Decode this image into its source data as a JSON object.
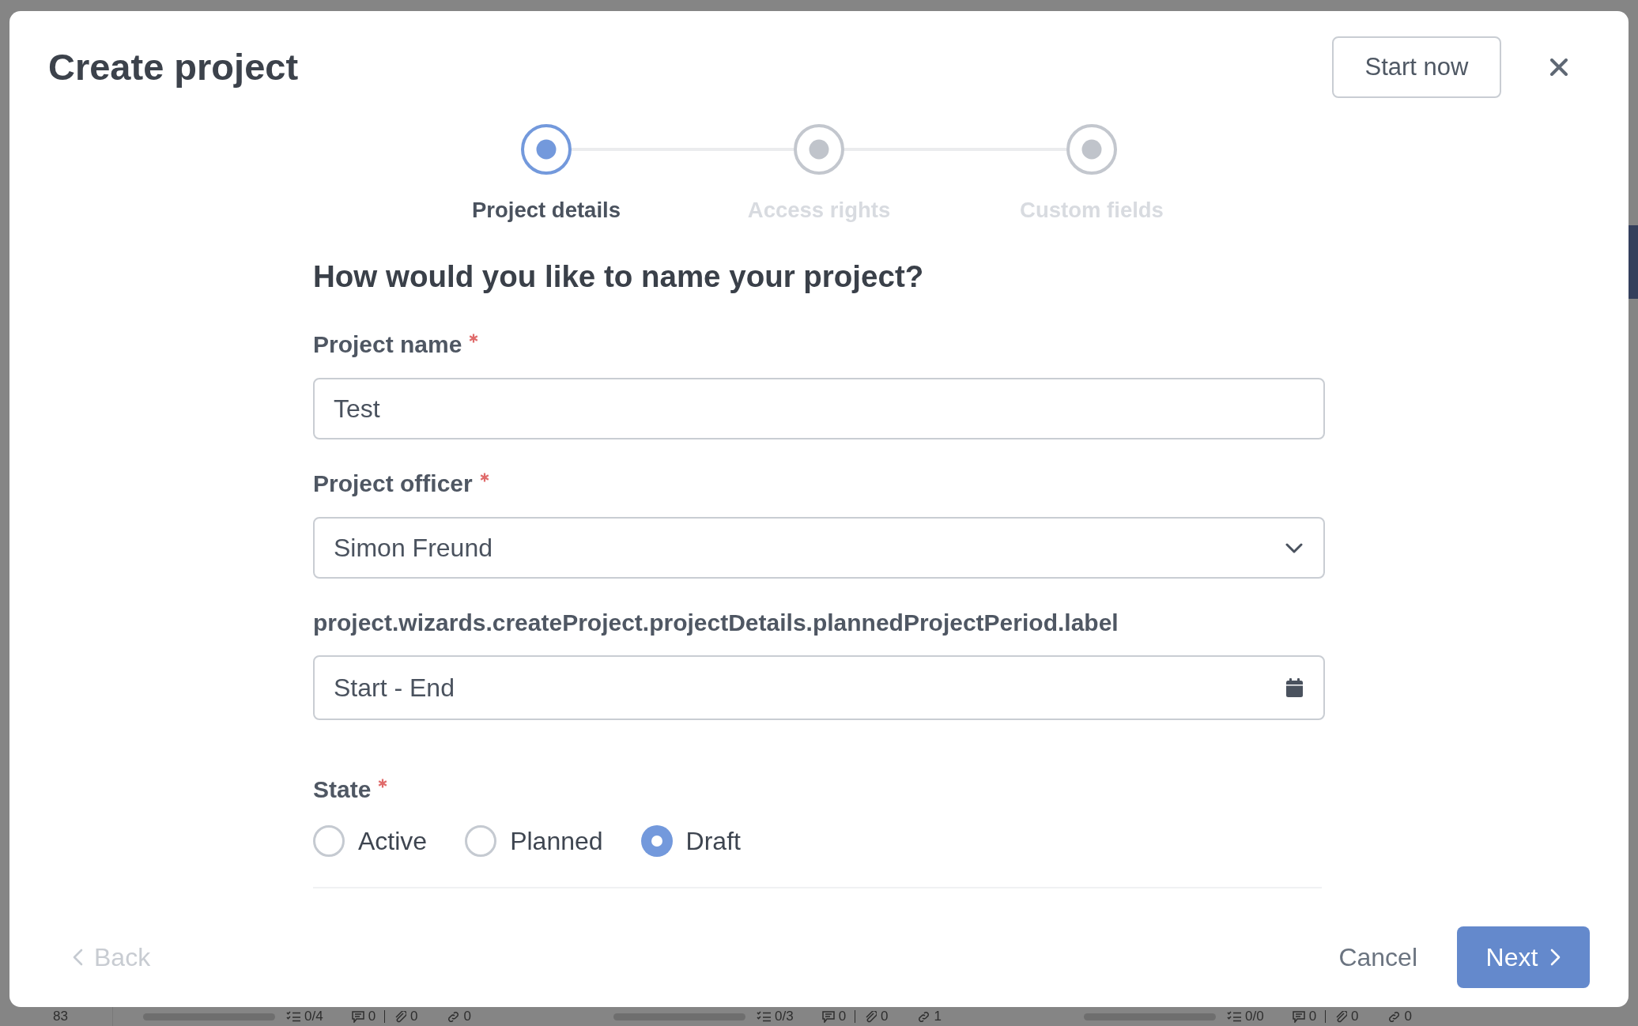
{
  "background": {
    "row_number": "83",
    "cards": [
      {
        "checklist": "0/4",
        "comments": "0",
        "attachments": "0",
        "links": "0"
      },
      {
        "checklist": "0/3",
        "comments": "0",
        "attachments": "0",
        "links": "1"
      },
      {
        "checklist": "0/0",
        "comments": "0",
        "attachments": "0",
        "links": "0"
      }
    ]
  },
  "dialog": {
    "title": "Create project",
    "start_button": "Start now",
    "steps": [
      {
        "label": "Project details",
        "selected": true
      },
      {
        "label": "Access rights",
        "selected": false
      },
      {
        "label": "Custom fields",
        "selected": false
      }
    ],
    "question": "How would you like to name your project?",
    "fields": [
      {
        "kind": "text",
        "label": "Project name",
        "required": true,
        "value": "Test"
      },
      {
        "kind": "select",
        "label": "Project officer",
        "required": true,
        "value": "Simon Freund"
      },
      {
        "kind": "date",
        "label": "project.wizards.createProject.projectDetails.plannedProjectPeriod.label",
        "required": false,
        "placeholder": "Start - End"
      }
    ],
    "state": {
      "label": "State",
      "required": true,
      "options": [
        {
          "label": "Active",
          "selected": false
        },
        {
          "label": "Planned",
          "selected": false
        },
        {
          "label": "Draft",
          "selected": true
        }
      ]
    },
    "footer": {
      "back": {
        "label": "Back",
        "disabled": true
      },
      "cancel": "Cancel",
      "next": "Next"
    }
  }
}
